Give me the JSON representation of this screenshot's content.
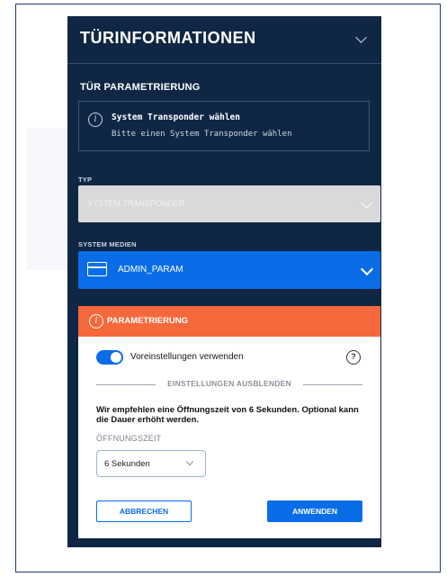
{
  "panel": {
    "title": "TÜRINFORMATIONEN",
    "section_title": "TÜR PARAMETRIERUNG"
  },
  "info": {
    "title": "System Transponder wählen",
    "text": "Bitte einen System Transponder wählen"
  },
  "typ": {
    "label": "TYP",
    "value": "SYSTEM TRANSPONDER"
  },
  "system_medien": {
    "label": "SYSTEM MEDIEN",
    "value": "ADMIN_PARAM"
  },
  "parametrierung": {
    "header": "PARAMETRIERUNG",
    "toggle_label": "Voreinstellungen verwenden",
    "toggle_on": true,
    "help": "?",
    "divider_label": "EINSTELLUNGEN AUSBLENDEN",
    "recommendation": "Wir empfehlen eine Öffnungszeit von 6 Sekunden. Optional kann die Dauer erhöht werden.",
    "opening_time_label": "ÖFFNUNGSZEIT",
    "opening_time_value": "6 Sekunden",
    "cancel_label": "ABBRECHEN",
    "apply_label": "ANWENDEN"
  },
  "colors": {
    "panel_bg": "#0f2744",
    "accent_blue": "#0a6de8",
    "warning_orange": "#f4683b"
  }
}
